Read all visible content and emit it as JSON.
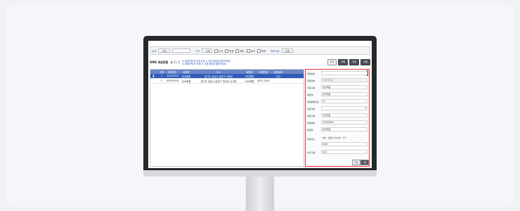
{
  "filter": {
    "label1": "검색",
    "select1": "- 전체 -",
    "label2": "기간",
    "select2": "- 전체",
    "checks": [
      "신규",
      "변경",
      "해지",
      "정지",
      "재개"
    ],
    "label3": "처리구분",
    "select3": "- 전체 -"
  },
  "title_row": {
    "title": "DMS 회원현황",
    "count": "총 2 / 1",
    "note1": "※ 회원선택 후 정보수정 시 저장 버튼을 클릭하세요.",
    "note2": "※ 회원선택 후 삭제 시 삭제 버튼을 클릭하세요.",
    "buttons": [
      "신규",
      "조회",
      "저장",
      "삭제"
    ]
  },
  "grid": {
    "columns": [
      "선택",
      "회원번호",
      "회원명",
      "주소",
      "회원명",
      "회원전화",
      "회원등록"
    ],
    "rows": [
      {
        "num": "1",
        "id": "00000010",
        "name": "한국회원",
        "addr": "경기도 성남시 분당구 서현로",
        "kind": "개인회원",
        "tel": "",
        "reg": "신규"
      },
      {
        "num": "2",
        "id": "00000018",
        "name": "SAS회원",
        "addr": "경기도 성남시 분당구 판교로 신사업",
        "kind": "SAS회원",
        "tel": "0001-0001",
        "reg": ""
      }
    ]
  },
  "detail": {
    "fields": [
      {
        "label": "회원번호",
        "value": ""
      },
      {
        "label": "회원번호",
        "value": "00000010"
      },
      {
        "label": "회원구분",
        "value": "개인회원"
      },
      {
        "label": "회원명",
        "value": "한국회원"
      },
      {
        "label": "회원등록번호",
        "value": "01"
      },
      {
        "label": "회원구분",
        "value": "4"
      },
      {
        "label": "회원구분",
        "value": "개인회원"
      },
      {
        "label": "회원번호",
        "value": "12345000"
      },
      {
        "label": "회원명",
        "value": "한국회원"
      },
      {
        "label": "회원주소",
        "value": "서울 · 성동구 성수동 · 2가"
      },
      {
        "label": "",
        "value": "0002"
      },
      {
        "label": "처리구분",
        "value": "신규"
      }
    ],
    "buttons": [
      "저장",
      "삭제"
    ]
  }
}
